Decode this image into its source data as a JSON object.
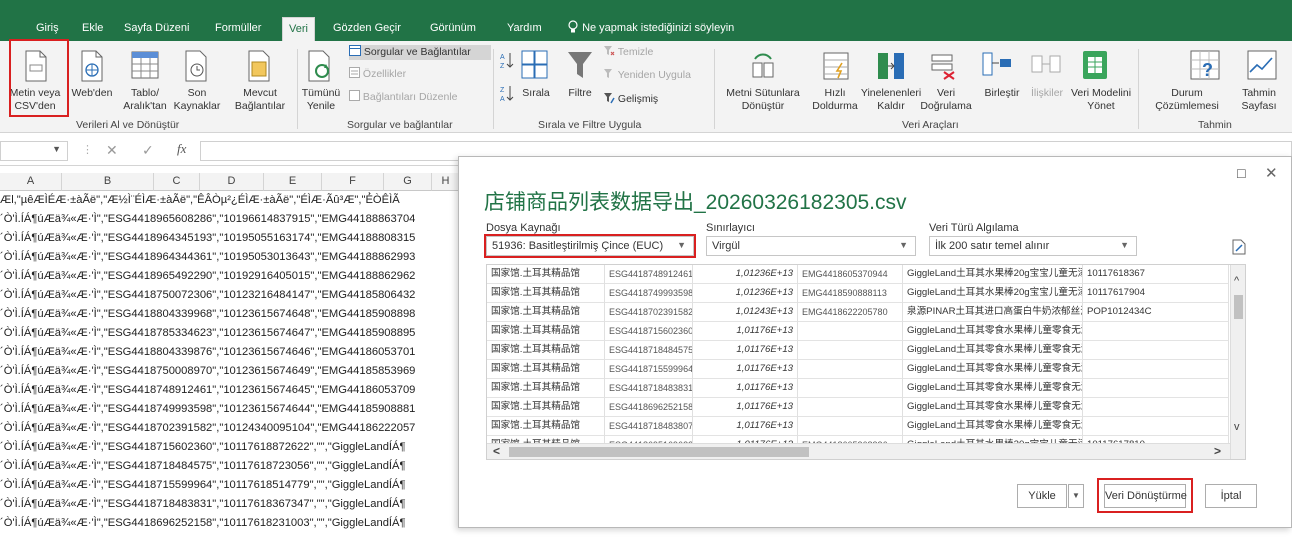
{
  "ribbon": {
    "tabs": [
      "Giriş",
      "Ekle",
      "Sayfa Düzeni",
      "Formüller",
      "Veri",
      "Gözden Geçir",
      "Görünüm",
      "Yardım"
    ],
    "active_tab": "Veri",
    "tell_me": "Ne yapmak istediğinizi söyleyin",
    "group_get_data": {
      "label": "Verileri Al ve Dönüştür",
      "from_text_csv": "Metin veya\nCSV'den",
      "from_web": "Web'den",
      "from_table": "Tablo/\nAralık'tan",
      "recent_sources": "Son\nKaynaklar",
      "existing_connections": "Mevcut\nBağlantılar"
    },
    "group_queries": {
      "label": "Sorgular ve bağlantılar",
      "refresh_all": "Tümünü\nYenile",
      "queries_connections": "Sorgular ve Bağlantılar",
      "properties": "Özellikler",
      "edit_links": "Bağlantıları Düzenle"
    },
    "group_sort_filter": {
      "label": "Sırala ve Filtre Uygula",
      "sort": "Sırala",
      "filter": "Filtre",
      "clear": "Temizle",
      "reapply": "Yeniden Uygula",
      "advanced": "Gelişmiş"
    },
    "group_data_tools": {
      "label": "Veri Araçları",
      "text_to_columns": "Metni Sütunlara\nDönüştür",
      "flash_fill": "Hızlı\nDoldurma",
      "remove_duplicates": "Yinelenenleri\nKaldır",
      "data_validation": "Veri\nDoğrulama",
      "consolidate": "Birleştir",
      "relationships": "İlişkiler",
      "data_model": "Veri Modelini\nYönet"
    },
    "group_forecast": {
      "label": "Tahmin",
      "what_if": "Durum\nÇözümlemesi",
      "forecast_sheet": "Tahmin\nSayfası"
    }
  },
  "formula_bar": {
    "fx": "fx"
  },
  "sheet": {
    "columns": [
      "A",
      "B",
      "C",
      "D",
      "E",
      "F",
      "G",
      "H"
    ],
    "rows": [
      "Æl,\"µêÆÌÉÆ·±àÃë\",\"Æ½Ì¨ÉÌÆ·±àÃë\",\"ÊÂÒµ²¿ÉÌÆ·±àÃë\",\"ÉÌÆ·Ãû³Æ\",\"É̾ÒÊÌÃ",
      "´Ò'Ì.ÍÁ¶úÆä¾«Æ·'Ì\",\"ESG4418965608286\",\"10196614837915\",\"EMG44188863704",
      "´Ò'Ì.ÍÁ¶úÆä¾«Æ·'Ì\",\"ESG4418964345193\",\"10195055163174\",\"EMG44188808315",
      "´Ò'Ì.ÍÁ¶úÆä¾«Æ·'Ì\",\"ESG4418964344361\",\"10195053013643\",\"EMG44188862993",
      "´Ò'Ì.ÍÁ¶úÆä¾«Æ·'Ì\",\"ESG4418965492290\",\"10192916405015\",\"EMG44188862962",
      "´Ò'Ì.ÍÁ¶úÆä¾«Æ·'Ì\",\"ESG4418750072306\",\"10123216484147\",\"EMG44185806432",
      "´Ò'Ì.ÍÁ¶úÆä¾«Æ·'Ì\",\"ESG4418804339968\",\"10123615674648\",\"EMG44185908898",
      "´Ò'Ì.ÍÁ¶úÆä¾«Æ·'Ì\",\"ESG4418785334623\",\"10123615674647\",\"EMG44185908895",
      "´Ò'Ì.ÍÁ¶úÆä¾«Æ·'Ì\",\"ESG4418804339876\",\"10123615674646\",\"EMG44186053701",
      "´Ò'Ì.ÍÁ¶úÆä¾«Æ·'Ì\",\"ESG4418750008970\",\"10123615674649\",\"EMG44185853969",
      "´Ò'Ì.ÍÁ¶úÆä¾«Æ·'Ì\",\"ESG4418748912461\",\"10123615674645\",\"EMG44186053709",
      "´Ò'Ì.ÍÁ¶úÆä¾«Æ·'Ì\",\"ESG4418749993598\",\"10123615674644\",\"EMG44185908881",
      "´Ò'Ì.ÍÁ¶úÆä¾«Æ·'Ì\",\"ESG4418702391582\",\"10124340095104\",\"EMG44186222057",
      "´Ò'Ì.ÍÁ¶úÆä¾«Æ·'Ì\",\"ESG4418715602360\",\"10117618872622\",\"\",\"GiggleLandÍÁ¶",
      "´Ò'Ì.ÍÁ¶úÆä¾«Æ·'Ì\",\"ESG4418718484575\",\"10117618723056\",\"\",\"GiggleLandÍÁ¶",
      "´Ò'Ì.ÍÁ¶úÆä¾«Æ·'Ì\",\"ESG4418715599964\",\"10117618514779\",\"\",\"GiggleLandÍÁ¶",
      "´Ò'Ì.ÍÁ¶úÆä¾«Æ·'Ì\",\"ESG4418718483831\",\"10117618367347\",\"\",\"GiggleLandÍÁ¶",
      "´Ò'Ì.ÍÁ¶úÆä¾«Æ·'Ì\",\"ESG4418696252158\",\"10117618231003\",\"\",\"GiggleLandÍÁ¶"
    ]
  },
  "dialog": {
    "title": "店铺商品列表数据导出_20260326182305.csv",
    "file_origin_label": "Dosya Kaynağı",
    "file_origin_value": "51936: Basitleştirilmiş Çince (EUC)",
    "delimiter_label": "Sınırlayıcı",
    "delimiter_value": "Virgül",
    "type_detection_label": "Veri Türü Algılama",
    "type_detection_value": "İlk 200 satır temel alınır",
    "preview_rows": [
      [
        "国家馆.土耳其精品馆",
        "ESG4418748912461",
        "1,01236E+13",
        "EMG4418605370944",
        "GiggleLand土耳其水果棒20g宝宝儿童无添加健康有...",
        "10117618367"
      ],
      [
        "国家馆.土耳其精品馆",
        "ESG4418749993598",
        "1,01236E+13",
        "EMG4418590888113",
        "GiggleLand土耳其水果棒20g宝宝儿童无添加健康有...",
        "10117617904"
      ],
      [
        "国家馆.土耳其精品馆",
        "ESG4418702391582",
        "1,01243E+13",
        "EMG4418622205780",
        "泉源PINAR土耳其进口高蛋白牛奶浓郁丝滑健身学生...",
        "POP1012434C"
      ],
      [
        "国家馆.土耳其精品馆",
        "ESG4418715602360",
        "1,01176E+13",
        "",
        "GiggleLand土耳其零食水果棒儿童零食无添加健康营...",
        ""
      ],
      [
        "国家馆.土耳其精品馆",
        "ESG4418718484575",
        "1,01176E+13",
        "",
        "GiggleLand土耳其零食水果棒儿童零食无添加健康营...",
        ""
      ],
      [
        "国家馆.土耳其精品馆",
        "ESG4418715599964",
        "1,01176E+13",
        "",
        "GiggleLand土耳其零食水果棒儿童零食无添加健康营...",
        ""
      ],
      [
        "国家馆.土耳其精品馆",
        "ESG4418718483831",
        "1,01176E+13",
        "",
        "GiggleLand土耳其零食水果棒儿童零食无添加健康营...",
        ""
      ],
      [
        "国家馆.土耳其精品馆",
        "ESG4418696252158",
        "1,01176E+13",
        "",
        "GiggleLand土耳其零食水果棒儿童零食无添加健康营...",
        ""
      ],
      [
        "国家馆.土耳其精品馆",
        "ESG4418718483807",
        "1,01176E+13",
        "",
        "GiggleLand土耳其零食水果棒儿童零食无添加健康营...",
        ""
      ],
      [
        "国家馆.土耳其精品馆",
        "ESG4418695169633",
        "1,01176E+13",
        "EMG4418605368336",
        "GiggleLand土耳其水果棒20g宝宝儿童无添加健康有...",
        "10117617810"
      ]
    ],
    "load_button": "Yükle",
    "transform_button": "Veri Dönüştürme",
    "cancel_button": "İptal"
  },
  "colors": {
    "excel_green": "#217346",
    "highlight_red": "#d92020"
  }
}
